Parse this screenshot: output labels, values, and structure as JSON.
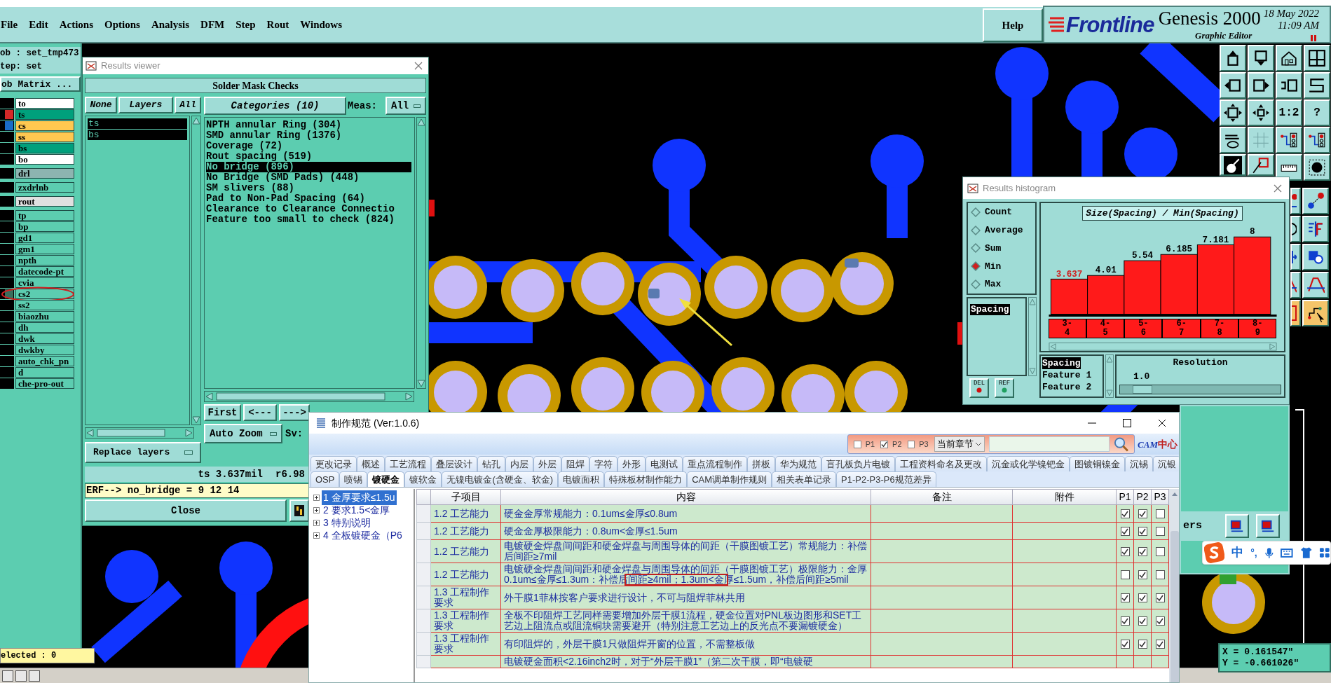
{
  "menu_bar": {
    "items": [
      "File",
      "Edit",
      "Actions",
      "Options",
      "Analysis",
      "DFM",
      "Step",
      "Rout",
      "Windows"
    ],
    "help": "Help"
  },
  "branding": {
    "logo": "Frontline",
    "product": "Genesis 2000",
    "subtitle": "Graphic Editor",
    "date": "18 May 2022",
    "time": "11:09 AM"
  },
  "job_panel": {
    "job": "ob : set_tmp473",
    "step": "tep: set",
    "matrix": "ob Matrix ...",
    "layer_groups": [
      {
        "layers": [
          {
            "name": "to",
            "color": "#ffffff",
            "circled": false
          },
          {
            "name": "ts",
            "color": "#00a07c",
            "marker": {
              "color": "#d42828"
            },
            "circled": false
          },
          {
            "name": "cs",
            "color": "#ffc850",
            "marker": {
              "color": "#1a6cc8"
            },
            "circled": false
          },
          {
            "name": "ss",
            "color": "#ffc850",
            "circled": false
          },
          {
            "name": "bs",
            "color": "#00a07c",
            "circled": false
          },
          {
            "name": "bo",
            "color": "#ffffff",
            "circled": false
          }
        ]
      },
      {
        "layers": [
          {
            "name": "drl",
            "color": "#8db4b0",
            "circled": false
          }
        ]
      },
      {
        "layers": [
          {
            "name": "zxdrlnb",
            "color": "#5ccdb0",
            "circled": false
          }
        ]
      },
      {
        "layers": [
          {
            "name": "rout",
            "color": "#e0e0e0",
            "circled": false
          }
        ]
      },
      {
        "layers": [
          {
            "name": "tp",
            "color": "#5ccdb0",
            "circled": false
          },
          {
            "name": "bp",
            "color": "#5ccdb0",
            "circled": false
          },
          {
            "name": "gd1",
            "color": "#5ccdb0",
            "circled": false
          },
          {
            "name": "gm1",
            "color": "#5ccdb0",
            "circled": false
          },
          {
            "name": "npth",
            "color": "#5ccdb0",
            "circled": false
          },
          {
            "name": "datecode-pt",
            "color": "#5ccdb0",
            "circled": false
          },
          {
            "name": "cvia",
            "color": "#5ccdb0",
            "circled": false
          },
          {
            "name": "cs2",
            "color": "#5ccdb0",
            "marker": {
              "color": "#3a6e5c"
            },
            "circled": true
          },
          {
            "name": "ss2",
            "color": "#5ccdb0",
            "circled": false
          },
          {
            "name": "biaozhu",
            "color": "#5ccdb0",
            "circled": false
          },
          {
            "name": "dh",
            "color": "#5ccdb0",
            "circled": false
          },
          {
            "name": "dwk",
            "color": "#5ccdb0",
            "circled": false
          },
          {
            "name": "dwkby",
            "color": "#5ccdb0",
            "circled": false
          },
          {
            "name": "auto_chk_pn",
            "color": "#5ccdb0",
            "circled": false
          },
          {
            "name": "d",
            "color": "#5ccdb0",
            "circled": false
          },
          {
            "name": "che-pro-out",
            "color": "#5ccdb0",
            "circled": false
          }
        ]
      }
    ],
    "status": "elected : 0"
  },
  "results_viewer": {
    "title": "Results viewer",
    "heading": "Solder Mask Checks",
    "layer_buttons": [
      "None",
      "Layers",
      "All"
    ],
    "layers": [
      {
        "name": "ts",
        "selected": true
      },
      {
        "name": "bs",
        "selected": true
      }
    ],
    "categories_button": "Categories (10)",
    "meas_label": "Meas:",
    "meas_value": "All",
    "categories": [
      {
        "label": "NPTH annular Ring (304)",
        "selected": false
      },
      {
        "label": "SMD annular Ring (1376)",
        "selected": false
      },
      {
        "label": "Coverage (72)",
        "selected": false
      },
      {
        "label": "Rout spacing (519)",
        "selected": false
      },
      {
        "label": "No bridge (896)",
        "selected": true
      },
      {
        "label": "No Bridge (SMD Pads) (448)",
        "selected": false
      },
      {
        "label": "SM slivers (88)",
        "selected": false
      },
      {
        "label": "Pad to Non-Pad Spacing (64)",
        "selected": false
      },
      {
        "label": "Clearance to Clearance Connectio",
        "selected": false
      },
      {
        "label": "Feature too small to check (824)",
        "selected": false
      }
    ],
    "nav_buttons": [
      "First",
      "<---",
      "--->"
    ],
    "zoom_mode": "Auto Zoom",
    "save_label": "Sv:",
    "replace_mode": "Replace layers",
    "measurement": "ts 3.637mil",
    "ratio": "r6.98",
    "erf": "ERF--> no_bridge = 9 12 14",
    "close": "Close"
  },
  "toolbar": [
    {
      "kind": "box-up"
    },
    {
      "kind": "box-down"
    },
    {
      "kind": "house"
    },
    {
      "kind": "window-grid"
    },
    {
      "kind": "box-left"
    },
    {
      "kind": "box-right"
    },
    {
      "kind": "undo-box"
    },
    {
      "kind": "zigzag"
    },
    {
      "kind": "fit"
    },
    {
      "kind": "center"
    },
    {
      "kind": "label",
      "label": "1:2"
    },
    {
      "kind": "label",
      "label": "?"
    },
    {
      "kind": "tools"
    },
    {
      "kind": "grid"
    },
    {
      "kind": "circuit"
    },
    {
      "kind": "circuit"
    },
    {
      "kind": "shape"
    },
    {
      "kind": "square-line"
    },
    {
      "kind": "ruler"
    },
    {
      "kind": "dot-square"
    }
  ],
  "side_toolbar": [
    {
      "kind": "red-dot"
    },
    {
      "kind": "dot-link"
    },
    {
      "kind": "ring"
    },
    {
      "kind": "mirror"
    },
    {
      "kind": "arrow-in"
    },
    {
      "kind": "blue-shapes"
    },
    {
      "kind": "trapezoid"
    },
    {
      "kind": "trapezoid"
    },
    {
      "kind": "orange-box"
    },
    {
      "kind": "circuit-cursor"
    }
  ],
  "histogram": {
    "title": "Results histogram",
    "modes": [
      {
        "label": "Count",
        "selected": false
      },
      {
        "label": "Average",
        "selected": false
      },
      {
        "label": "Sum",
        "selected": false
      },
      {
        "label": "Min",
        "selected": true
      },
      {
        "label": "Max",
        "selected": false
      }
    ],
    "attributes": [
      {
        "label": "Spacing",
        "selected": true
      }
    ],
    "buttons": [
      "DEL",
      "REF"
    ],
    "chart_data": {
      "type": "bar",
      "title": "Size(Spacing) / Min(Spacing)",
      "categories": [
        "3-4",
        "4-5",
        "5-6",
        "6-7",
        "7-8",
        "8-9"
      ],
      "values": [
        3.637,
        4.01,
        5.54,
        6.185,
        7.181,
        8
      ],
      "data_labels": true
    },
    "fields": [
      {
        "label": "Spacing",
        "selected": true
      },
      {
        "label": "Feature 1",
        "selected": false
      },
      {
        "label": "Feature 2",
        "selected": false
      }
    ],
    "resolution_label": "Resolution",
    "resolution": "1.0",
    "resolution_slider": {
      "level": 0.08
    }
  },
  "side_panel": {
    "label": "ers"
  },
  "spec_window": {
    "title": "制作规范 (Ver:1.0.6)",
    "filters": [
      {
        "label": "P1",
        "checked": false
      },
      {
        "label": "P2",
        "checked": true
      },
      {
        "label": "P3",
        "checked": false
      }
    ],
    "scope": "当前章节",
    "logo_latin": "CAM",
    "logo_cjk": "中心",
    "tabs_row1": [
      {
        "label": "更改记录",
        "selected": false
      },
      {
        "label": "概述",
        "selected": false
      },
      {
        "label": "工艺流程",
        "selected": false
      },
      {
        "label": "叠层设计",
        "selected": false
      },
      {
        "label": "钻孔",
        "selected": false
      },
      {
        "label": "内层",
        "selected": false
      },
      {
        "label": "外层",
        "selected": false
      },
      {
        "label": "阻焊",
        "selected": false
      },
      {
        "label": "字符",
        "selected": false
      },
      {
        "label": "外形",
        "selected": false
      },
      {
        "label": "电测试",
        "selected": false
      },
      {
        "label": "重点流程制作",
        "selected": false
      },
      {
        "label": "拼板",
        "selected": false
      },
      {
        "label": "华为规范",
        "selected": false
      },
      {
        "label": "盲孔板负片电镀",
        "selected": false
      },
      {
        "label": "工程资料命名及更改",
        "selected": false
      },
      {
        "label": "沉金或化学镍钯金",
        "selected": false
      },
      {
        "label": "图镀铜镍金",
        "selected": false
      },
      {
        "label": "沉锡",
        "selected": false
      },
      {
        "label": "沉银",
        "selected": false
      }
    ],
    "tabs_row2": [
      {
        "label": "OSP",
        "selected": false
      },
      {
        "label": "喷锡",
        "selected": false
      },
      {
        "label": "镀硬金",
        "selected": true
      },
      {
        "label": "镀软金",
        "selected": false
      },
      {
        "label": "无镍电镀金(含硬金、软金)",
        "selected": false
      },
      {
        "label": "电镀面积",
        "selected": false
      },
      {
        "label": "特殊板材制作能力",
        "selected": false
      },
      {
        "label": "CAM调单制作规则",
        "selected": false
      },
      {
        "label": "相关表单记录",
        "selected": false
      },
      {
        "label": "P1-P2-P3-P6规范差异",
        "selected": false
      }
    ],
    "tree": [
      {
        "label": "1 金厚要求≤1.5u",
        "selected": true
      },
      {
        "label": "2 要求1.5<金厚",
        "selected": false
      },
      {
        "label": "3 特别说明",
        "selected": false
      },
      {
        "label": "4 全板镀硬金（P6",
        "selected": false
      }
    ],
    "columns": [
      "子项目",
      "内容",
      "备注",
      "附件",
      "P1",
      "P2",
      "P3"
    ],
    "rows": [
      {
        "subitem": "1.2 工艺能力",
        "content": "硬金金厚常规能力：0.1um≤金厚≤0.8um",
        "p1": true,
        "p2": true,
        "p3": false,
        "annotated": false
      },
      {
        "subitem": "1.2 工艺能力",
        "content": "硬金金厚极限能力：0.8um<金厚≤1.5um",
        "p1": true,
        "p2": true,
        "p3": false,
        "annotated": false
      },
      {
        "subitem": "1.2 工艺能力",
        "content": "电镀硬金焊盘间间距和硬金焊盘与周围导体的间距（干膜图镀工艺）常规能力：补偿后间距≥7mil",
        "p1": true,
        "p2": true,
        "p3": false,
        "annotated": false
      },
      {
        "subitem": "1.2 工艺能力",
        "content": "电镀硬金焊盘间间距和硬金焊盘与周围导体的间距（干膜图镀工艺）极限能力：金厚0.1um≤金厚≤1.3um：补偿后间距≥4mil；1.3um<金厚≤1.5um，补偿后间距≥5mil",
        "p1": false,
        "p2": true,
        "p3": false,
        "annotated": true
      },
      {
        "subitem": "1.3 工程制作要求",
        "content": "外干膜1菲林按客户要求进行设计，不可与阻焊菲林共用",
        "p1": true,
        "p2": true,
        "p3": true,
        "annotated": false
      },
      {
        "subitem": "1.3 工程制作要求",
        "content": "全板不印阻焊工艺同样需要增加外层干膜1流程，硬金位置对PNL板边图形和SET工艺边上阻流点或阻流铜块需要避开（特别注意工艺边上的反光点不要漏镀硬金）",
        "p1": true,
        "p2": true,
        "p3": true,
        "annotated": false
      },
      {
        "subitem": "1.3 工程制作要求",
        "content": "有印阻焊的，外层干膜1只做阻焊开窗的位置，不需整板做",
        "p1": true,
        "p2": true,
        "p3": true,
        "annotated": false
      },
      {
        "content": "电镀硬金面积<2.16inch2时，对于“外层干膜1”（第二次干膜，即“电镀硬",
        "annotated": false
      }
    ]
  },
  "ime_toolbar": {
    "mode": "中",
    "punctuation": "°,"
  },
  "coordinates": {
    "x": "X = 0.161547\"",
    "y": "Y = -0.661026\""
  }
}
